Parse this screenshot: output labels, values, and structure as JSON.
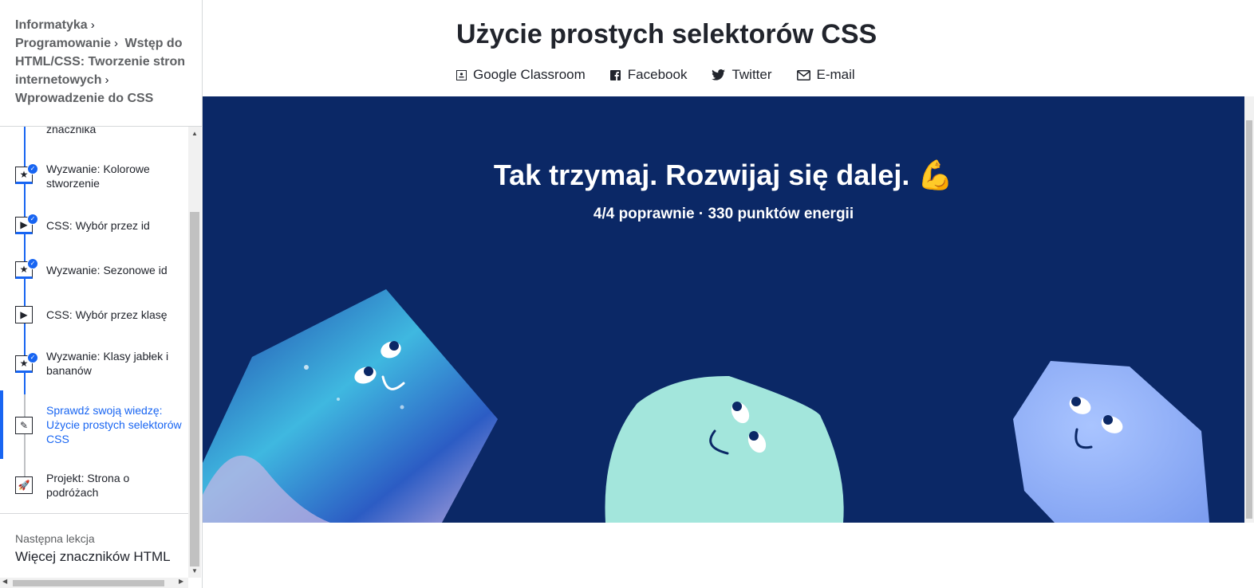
{
  "breadcrumb": {
    "items": [
      "Informatyka",
      "Programowanie",
      "Wstęp do HTML/CSS: Tworzenie stron internetowych",
      "Wprowadzenie do CSS"
    ]
  },
  "lessons": [
    {
      "label": "znacznika",
      "icon": "star-icon",
      "done": true
    },
    {
      "label": "Wyzwanie: Kolorowe stworzenie",
      "icon": "star-icon",
      "done": true
    },
    {
      "label": "CSS: Wybór przez id",
      "icon": "play-icon",
      "done": true
    },
    {
      "label": "Wyzwanie: Sezonowe id",
      "icon": "star-icon",
      "done": true
    },
    {
      "label": "CSS: Wybór przez klasę",
      "icon": "play-icon",
      "done": false
    },
    {
      "label": "Wyzwanie: Klasy jabłek i bananów",
      "icon": "star-icon",
      "done": true
    },
    {
      "label": "Sprawdź swoją wiedzę: Użycie prostych selektorów CSS",
      "icon": "pencil-icon",
      "done": false,
      "active": true
    },
    {
      "label": "Projekt: Strona o podróżach",
      "icon": "rocket-icon",
      "done": false
    }
  ],
  "next_lesson": {
    "label": "Następna lekcja",
    "title": "Więcej znaczników HTML"
  },
  "page_title": "Użycie prostych selektorów CSS",
  "share": [
    {
      "label": "Google Classroom",
      "icon": "classroom-icon"
    },
    {
      "label": "Facebook",
      "icon": "facebook-icon"
    },
    {
      "label": "Twitter",
      "icon": "twitter-icon"
    },
    {
      "label": "E-mail",
      "icon": "mail-icon"
    }
  ],
  "banner": {
    "title": "Tak trzymaj. Rozwijaj się dalej.",
    "emoji": "💪",
    "subtitle": "4/4 poprawnie · 330 punktów energii",
    "bg_color": "#0b2866"
  },
  "colors": {
    "accent": "#1865f2",
    "text": "#21242c",
    "muted": "#5e6063"
  }
}
